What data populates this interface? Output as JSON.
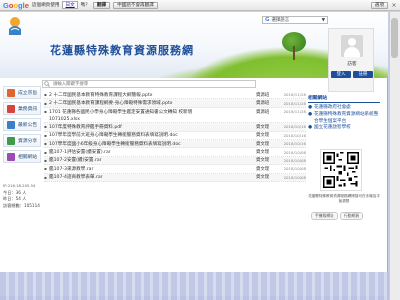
{
  "translate_bar": {
    "logo": [
      "G",
      "o",
      "o",
      "g",
      "l",
      "e"
    ],
    "message": "這個網頁使用",
    "language": "日文",
    "message2": "嗎？",
    "translate_button": "翻譯",
    "never_button": "中國語不會再翻譯",
    "options_button": "選項",
    "close_glyph": "×"
  },
  "header": {
    "site_title": "花蓮縣特殊教育資源服務網",
    "lang_select": "選擇語言",
    "lang_icon": "G",
    "lang_arrow": "▼"
  },
  "user": {
    "visitor": "訪客",
    "buttons": [
      "登入",
      "註冊"
    ]
  },
  "search": {
    "placeholder": "請輸入關鍵字搜尋"
  },
  "nav": [
    {
      "label": "成立宗旨",
      "color": "#e0662f"
    },
    {
      "label": "業務資訊",
      "color": "#d6453a"
    },
    {
      "label": "最新公告",
      "color": "#3b7fc7"
    },
    {
      "label": "資源分享",
      "color": "#3f9a4a"
    },
    {
      "label": "相關網站",
      "color": "#9b4cb3"
    }
  ],
  "stats": {
    "line1": "IP:216.18.205.54",
    "line2": "今日：36 人",
    "line3": "昨日：54 人",
    "line4": "訪客總數：105114"
  },
  "news": [
    {
      "title": "2 十二年國民基本教育特殊教育課程大綱簡報.pptx",
      "unit": "資源班",
      "date": "2018/11/28"
    },
    {
      "title": "2 十二年國民基本教育課程綱要-身心障礙特殊需求領域.pptx",
      "unit": "資源班",
      "date": "2018/11/28"
    },
    {
      "title": "1701 花蓮縣各國民小學身心障礙學生鑑定安置通知書公文轉知 校新增",
      "unit": "資源班",
      "date": "2018/11/28",
      "cont": "1071025.xlsx"
    },
    {
      "title": "107年度特殊教育評鑑手冊資料.pdf",
      "unit": "資文理",
      "date": "2018/10/16"
    },
    {
      "title": "107學年度學前大班身心障礙學生轉銜服務資料表填寫說明.doc",
      "unit": "資文理",
      "date": "2018/10/16"
    },
    {
      "title": "107學年度國小6年級身心障礙學生轉銜服務資料表填寫說明.doc",
      "unit": "資文理",
      "date": "2018/10/16"
    },
    {
      "title": "鑑107-1評估安置(續安置).rar",
      "unit": "資文理",
      "date": "2018/10/08"
    },
    {
      "title": "鑑107-2安置(續)安置.rar",
      "unit": "資文理",
      "date": "2018/10/08"
    },
    {
      "title": "鑑107-3來源教學.rar",
      "unit": "資文理",
      "date": "2018/10/08"
    },
    {
      "title": "鑑107-4諮商教學表單.rar",
      "unit": "資文理",
      "date": "2018/10/08"
    }
  ],
  "right": {
    "heading": "相關網站",
    "links": [
      "花蓮縣政府社會處",
      "花蓮縣特殊教育資源網站系統整合學生個案平台",
      "國立花蓮啟智學校"
    ],
    "qr_caption": "花蓮縣特殊教育資源服務網掃描可在手機及平板瀏覽",
    "qr_buttons": [
      "手機版網址",
      "行動網頁"
    ]
  }
}
